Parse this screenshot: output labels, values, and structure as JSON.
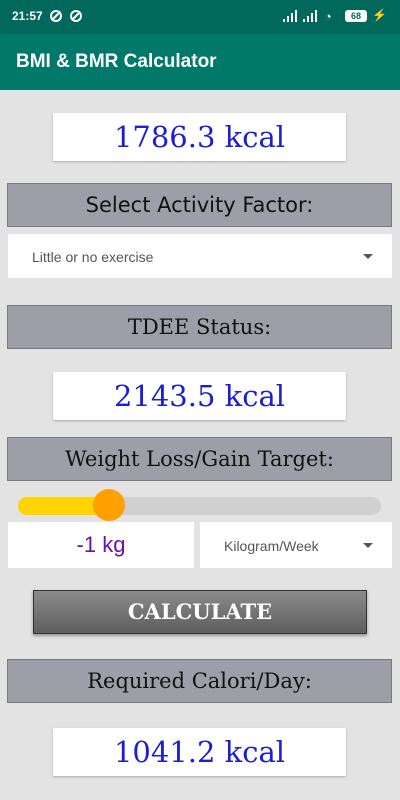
{
  "status_bar": {
    "time": "21:57",
    "battery": "68"
  },
  "app": {
    "title": "BMI & BMR Calculator"
  },
  "bmr": {
    "value": "1786.3 kcal"
  },
  "activity": {
    "header": "Select Activity Factor:",
    "selected": "Little or no exercise"
  },
  "tdee": {
    "header": "TDEE Status:",
    "value": "2143.5 kcal"
  },
  "target": {
    "header": "Weight Loss/Gain Target:",
    "slider_fraction": 0.25,
    "amount": "-1 kg",
    "unit_selected": "Kilogram/Week"
  },
  "calculate_label": "CALCULATE",
  "required": {
    "header": "Required Calori/Day:",
    "value": "1041.2 kcal"
  },
  "colors": {
    "appbar": "#00796b",
    "statusbar": "#00695c",
    "value_text": "#1a1fd1",
    "slider_fill": "#ffd400",
    "slider_thumb": "#ffa000"
  }
}
